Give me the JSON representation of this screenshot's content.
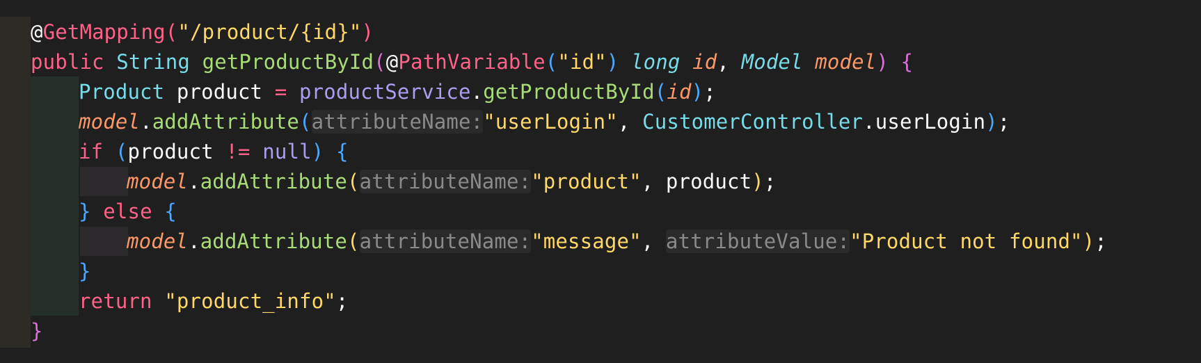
{
  "editor": {
    "lines": [
      {
        "tokens": [
          {
            "t": "@",
            "c": "punc"
          },
          {
            "t": "GetMapping",
            "c": "ann"
          },
          {
            "t": "(",
            "c": "b1"
          },
          {
            "t": "\"/product/{id}\"",
            "c": "str"
          },
          {
            "t": ")",
            "c": "b1"
          }
        ]
      },
      {
        "tokens": [
          {
            "t": "public",
            "c": "kw"
          },
          {
            "t": " ",
            "c": "punc"
          },
          {
            "t": "String",
            "c": "type"
          },
          {
            "t": " ",
            "c": "punc"
          },
          {
            "t": "getProductById",
            "c": "fn"
          },
          {
            "t": "(",
            "c": "b2"
          },
          {
            "t": "@",
            "c": "punc"
          },
          {
            "t": "PathVariable",
            "c": "ann"
          },
          {
            "t": "(",
            "c": "b3"
          },
          {
            "t": "\"id\"",
            "c": "str"
          },
          {
            "t": ")",
            "c": "b3"
          },
          {
            "t": " ",
            "c": "punc"
          },
          {
            "t": "long",
            "c": "italic-type"
          },
          {
            "t": " ",
            "c": "punc"
          },
          {
            "t": "id",
            "c": "italic-param"
          },
          {
            "t": ", ",
            "c": "punc"
          },
          {
            "t": "Model",
            "c": "italic-type"
          },
          {
            "t": " ",
            "c": "punc"
          },
          {
            "t": "model",
            "c": "italic-param"
          },
          {
            "t": ")",
            "c": "b2"
          },
          {
            "t": " ",
            "c": "punc"
          },
          {
            "t": "{",
            "c": "b2"
          }
        ]
      },
      {
        "tokens": [
          {
            "t": "Product",
            "c": "type"
          },
          {
            "t": " product ",
            "c": "var"
          },
          {
            "t": "=",
            "c": "op"
          },
          {
            "t": " ",
            "c": "punc"
          },
          {
            "t": "productService",
            "c": "svc"
          },
          {
            "t": ".",
            "c": "punc"
          },
          {
            "t": "getProductById",
            "c": "fn"
          },
          {
            "t": "(",
            "c": "b3"
          },
          {
            "t": "id",
            "c": "italic-param"
          },
          {
            "t": ")",
            "c": "b3"
          },
          {
            "t": ";",
            "c": "punc"
          }
        ]
      },
      {
        "tokens": [
          {
            "t": "model",
            "c": "italic-var"
          },
          {
            "t": ".",
            "c": "punc"
          },
          {
            "t": "addAttribute",
            "c": "fn"
          },
          {
            "t": "(",
            "c": "b3"
          },
          {
            "t": "attributeName:",
            "c": "hint"
          },
          {
            "t": "\"userLogin\"",
            "c": "str"
          },
          {
            "t": ", ",
            "c": "punc"
          },
          {
            "t": "CustomerController",
            "c": "type"
          },
          {
            "t": ".userLogin",
            "c": "var"
          },
          {
            "t": ")",
            "c": "b3"
          },
          {
            "t": ";",
            "c": "punc"
          }
        ]
      },
      {
        "tokens": [
          {
            "t": "if",
            "c": "kw"
          },
          {
            "t": " ",
            "c": "punc"
          },
          {
            "t": "(",
            "c": "b3"
          },
          {
            "t": "product ",
            "c": "var"
          },
          {
            "t": "!=",
            "c": "op"
          },
          {
            "t": " ",
            "c": "punc"
          },
          {
            "t": "null",
            "c": "kwnull"
          },
          {
            "t": ")",
            "c": "b3"
          },
          {
            "t": " ",
            "c": "punc"
          },
          {
            "t": "{",
            "c": "b3"
          }
        ]
      },
      {
        "tokens": [
          {
            "t": "model",
            "c": "italic-var"
          },
          {
            "t": ".",
            "c": "punc"
          },
          {
            "t": "addAttribute",
            "c": "fn"
          },
          {
            "t": "(",
            "c": "b4"
          },
          {
            "t": "attributeName:",
            "c": "hint"
          },
          {
            "t": "\"product\"",
            "c": "str"
          },
          {
            "t": ", product",
            "c": "punc"
          },
          {
            "t": ")",
            "c": "b4"
          },
          {
            "t": ";",
            "c": "punc"
          }
        ]
      },
      {
        "tokens": [
          {
            "t": "}",
            "c": "b3"
          },
          {
            "t": " ",
            "c": "punc"
          },
          {
            "t": "else",
            "c": "kw"
          },
          {
            "t": " ",
            "c": "punc"
          },
          {
            "t": "{",
            "c": "b3"
          }
        ]
      },
      {
        "tokens": [
          {
            "t": "model",
            "c": "italic-var"
          },
          {
            "t": ".",
            "c": "punc"
          },
          {
            "t": "addAttribute",
            "c": "fn"
          },
          {
            "t": "(",
            "c": "b4"
          },
          {
            "t": "attributeName:",
            "c": "hint"
          },
          {
            "t": "\"message\"",
            "c": "str"
          },
          {
            "t": ", ",
            "c": "punc"
          },
          {
            "t": "attributeValue:",
            "c": "hint"
          },
          {
            "t": "\"Product not found\"",
            "c": "str"
          },
          {
            "t": ")",
            "c": "b4"
          },
          {
            "t": ";",
            "c": "punc"
          }
        ]
      },
      {
        "tokens": [
          {
            "t": "}",
            "c": "b3"
          }
        ]
      },
      {
        "tokens": [
          {
            "t": "return",
            "c": "kw"
          },
          {
            "t": " ",
            "c": "punc"
          },
          {
            "t": "\"product_info\"",
            "c": "str"
          },
          {
            "t": ";",
            "c": "punc"
          }
        ]
      },
      {
        "tokens": [
          {
            "t": "}",
            "c": "b2"
          }
        ]
      }
    ]
  },
  "colors": {
    "background": "#1f1f1f",
    "gutter": "#2c2b25",
    "keyword": "#ff6188",
    "type": "#78dce8",
    "function": "#a9dc76",
    "string": "#ffd866",
    "parameter": "#fc9867",
    "service": "#ab9df2",
    "hint": "#8a8a8a"
  }
}
